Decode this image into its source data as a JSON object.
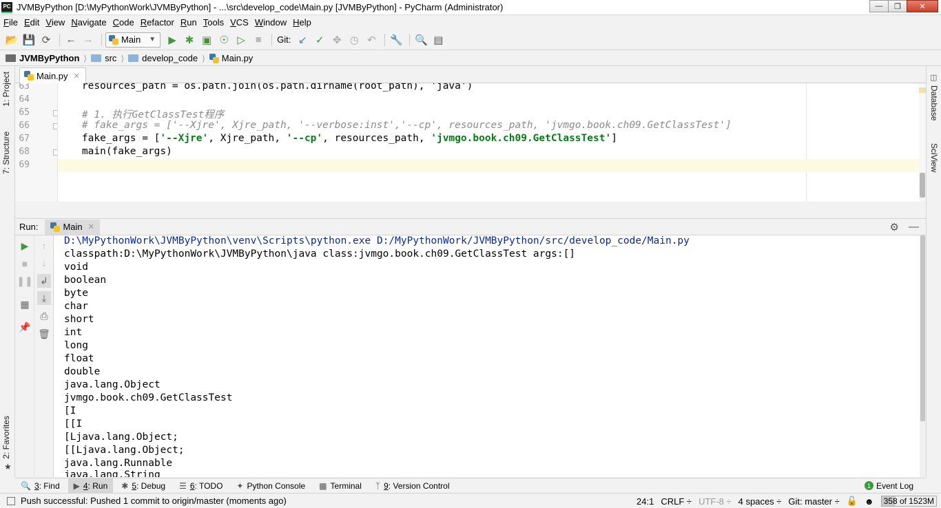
{
  "window": {
    "title": "JVMByPython [D:\\MyPythonWork\\JVMByPython] - ...\\src\\develop_code\\Main.py [JVMByPython] - PyCharm (Administrator)",
    "app_icon": "PC"
  },
  "menu": [
    "File",
    "Edit",
    "View",
    "Navigate",
    "Code",
    "Refactor",
    "Run",
    "Tools",
    "VCS",
    "Window",
    "Help"
  ],
  "toolbar": {
    "run_config": "Main",
    "git_label": "Git:"
  },
  "breadcrumb": [
    "JVMByPython",
    "src",
    "develop_code",
    "Main.py"
  ],
  "left_tool_tabs": {
    "project": "1: Project",
    "structure": "7: Structure",
    "favorites": "2: Favorites"
  },
  "right_tool_tabs": {
    "database": "Database",
    "sciview": "SciView"
  },
  "editor": {
    "tab": "Main.py",
    "lines": [
      {
        "num": "63",
        "text": "    resources_path = os.path.join(os.path.dirname(root_path), 'java')"
      },
      {
        "num": "64",
        "text": ""
      },
      {
        "num": "65",
        "text": "    # 1. 执行GetClassTest程序"
      },
      {
        "num": "66",
        "text": "    # fake_args = ['--Xjre', Xjre_path, '--verbose:inst','--cp', resources_path, 'jvmgo.book.ch09.GetClassTest']"
      },
      {
        "num": "67",
        "pre": "    fake_args = [",
        "s1": "'--Xjre'",
        "m1": ", Xjre_path, ",
        "s2": "'--cp'",
        "m2": ", resources_path, ",
        "s3": "'jvmgo.book.ch09.GetClassTest'",
        "post": "]"
      },
      {
        "num": "68",
        "text": "    main(fake_args)"
      },
      {
        "num": "69",
        "text": ""
      }
    ]
  },
  "run_panel": {
    "label": "Run:",
    "tab": "Main",
    "output": [
      "D:\\MyPythonWork\\JVMByPython\\venv\\Scripts\\python.exe D:/MyPythonWork/JVMByPython/src/develop_code/Main.py",
      "classpath:D:\\MyPythonWork\\JVMByPython\\java class:jvmgo.book.ch09.GetClassTest args:[]",
      "void",
      "boolean",
      "byte",
      "char",
      "short",
      "int",
      "long",
      "float",
      "double",
      "java.lang.Object",
      "jvmgo.book.ch09.GetClassTest",
      "[I",
      "[[I",
      "[Ljava.lang.Object;",
      "[[Ljava.lang.Object;",
      "java.lang.Runnable",
      "java.lang.String"
    ]
  },
  "bottom_tabs": [
    {
      "icon": "search-icon",
      "num": "3",
      "label": ": Find"
    },
    {
      "icon": "run-icon",
      "num": "4",
      "label": ": Run"
    },
    {
      "icon": "bug-icon",
      "num": "5",
      "label": ": Debug"
    },
    {
      "icon": "list-icon",
      "num": "6",
      "label": ": TODO"
    },
    {
      "icon": "python-icon",
      "num": "",
      "label": "Python Console"
    },
    {
      "icon": "terminal-icon",
      "num": "",
      "label": "Terminal"
    },
    {
      "icon": "vcs-icon",
      "num": "9",
      "label": ": Version Control"
    }
  ],
  "event_log": {
    "count": "1",
    "label": "Event Log"
  },
  "status": {
    "message": "Push successful: Pushed 1 commit to origin/master (moments ago)",
    "position": "24:1",
    "line_sep": "CRLF ÷",
    "encoding": "UTF-8 ÷",
    "indent": "4 spaces ÷",
    "branch": "Git: master ÷",
    "memory": "358 of 1523M"
  }
}
